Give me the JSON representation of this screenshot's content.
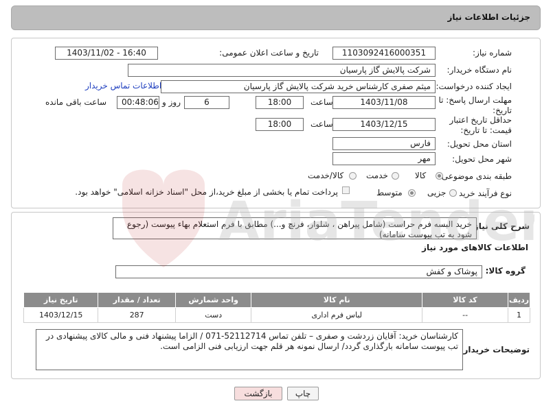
{
  "header": {
    "title": "جزئیات اطلاعات نیاز"
  },
  "form": {
    "need_number_label": "شماره نیاز:",
    "need_number": "1103092416000351",
    "announce_label": "تاریخ و ساعت اعلان عمومی:",
    "announce_value": "1403/11/02 - 16:40",
    "buyer_org_label": "نام دستگاه خریدار:",
    "buyer_org": "شرکت پالایش گاز پارسیان",
    "requester_label": "ایجاد کننده درخواست:",
    "requester": "میثم صفری کارشناس خرید شرکت پالایش گاز پارسیان",
    "buyer_contact_link": "اطلاعات تماس خریدار",
    "reply_deadline_label": "مهلت ارسال پاسخ: تا تاریخ:",
    "reply_date": "1403/11/08",
    "time_label": "ساعت",
    "reply_time": "18:00",
    "days_value": "6",
    "days_label": "روز و",
    "remaining_time": "00:48:06",
    "remaining_label": "ساعت باقی مانده",
    "price_validity_label": "حداقل تاریخ اعتبار قیمت: تا تاریخ:",
    "price_date": "1403/12/15",
    "price_time": "18:00",
    "province_label": "استان محل تحویل:",
    "province": "فارس",
    "city_label": "شهر محل تحویل:",
    "city": "مهر",
    "category_label": "طبقه بندی موضوعی:",
    "category_options": [
      "کالا",
      "خدمت",
      "کالا/خدمت"
    ],
    "process_label": "نوع فرآیند خرید :",
    "process_options": [
      "جزیی",
      "متوسط"
    ],
    "payment_note": "پرداخت تمام یا بخشی از مبلغ خرید،از محل \"اسناد خزانه اسلامی\" خواهد بود."
  },
  "details": {
    "desc_label": "شرح کلی نیاز:",
    "description": "خرید البسه فرم حراست (شامل پیراهن ، شلوار، فرنچ و...) مطابق با فرم استعلام بهاء پیوست (رجوع شود به تب پیوست سامانه)",
    "goods_info_title": "اطلاعات کالاهای مورد نیاز",
    "group_label": "گروه کالا:",
    "group_value": "پوشاک و کفش",
    "table": {
      "headers": [
        "ردیف",
        "کد کالا",
        "نام کالا",
        "واحد شمارش",
        "تعداد / مقدار",
        "تاریخ نیاز"
      ],
      "rows": [
        [
          "1",
          "--",
          "لباس فرم اداری",
          "دست",
          "287",
          "1403/12/15"
        ]
      ]
    },
    "buyer_notes_label": "توضیحات خریدار:",
    "buyer_notes": "کارشناسان خرید: آقایان زردشت و صفری – تلفن تماس 52112714-071 / الزاما پیشنهاد فنی و مالی کالای پیشنهادی در تب پیوست سامانه بارگذاری گردد/ ارسال نمونه هر قلم جهت ارزیابی فنی الزامی است."
  },
  "buttons": {
    "print": "چاپ",
    "back": "بازگشت"
  },
  "watermark": {
    "text": "AriaTender.neT"
  },
  "colors": {
    "header_bg": "#bdbdbd",
    "table_header_bg": "#8c8c8c",
    "back_btn_bg": "#f7dede",
    "link": "#1f3fbf"
  }
}
